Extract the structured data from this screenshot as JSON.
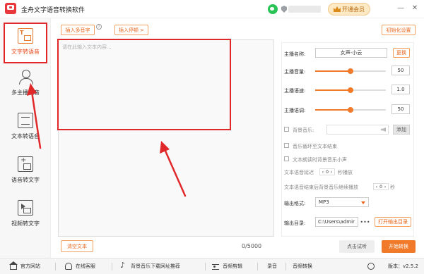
{
  "app": {
    "title": "金舟文字语音转换软件"
  },
  "header": {
    "vip_label": "开通会员",
    "minimize": "—",
    "close": "✕"
  },
  "sidebar": {
    "items": [
      {
        "label": "文字转语音"
      },
      {
        "label": "多主播配音"
      },
      {
        "label": "文本转语音"
      },
      {
        "label": "语音转文字"
      },
      {
        "label": "视频转文字"
      }
    ]
  },
  "toolbar": {
    "insert_polyphone": "插入多音字",
    "help": "?",
    "insert_pause": "插入停顿 >",
    "init_settings": "初始化设置"
  },
  "editor": {
    "placeholder": "请在此输入文本内容...",
    "counter": "0/5000",
    "clear_label": "清空文本"
  },
  "settings": {
    "anchor_name_label": "主播名称:",
    "anchor_name_value": "女声-小云",
    "change_label": "更换",
    "volume_label": "主播音量:",
    "volume_value": "50",
    "speed_label": "主播语速:",
    "speed_value": "1.0",
    "pitch_label": "主播语调:",
    "pitch_value": "50",
    "bgm_label": "背景音乐:",
    "add_label": "添加",
    "loop_label": "音乐循环至文本结束",
    "lower_label": "文本朗读时背景音乐小声",
    "delay_prefix": "文本语音延迟",
    "delay_value": "0",
    "delay_suffix": "秒播放",
    "after_prefix": "文本语音结束后背景音乐继续播放",
    "after_value": "0",
    "after_suffix": "秒",
    "format_label": "输出格式:",
    "format_value": "MP3",
    "dir_label": "输出目录:",
    "dir_value": "C:\\Users\\admir",
    "dir_more": "•••",
    "open_dir_label": "打开输出目录"
  },
  "actions": {
    "preview_label": "点击试听",
    "start_label": "开始转换"
  },
  "footer": {
    "items": [
      {
        "label": "官方网站"
      },
      {
        "label": "在线客服"
      },
      {
        "label": "背景音乐下载网址推荐"
      },
      {
        "label": "音频剪辑"
      },
      {
        "label": "录音"
      },
      {
        "label": "音频转换"
      }
    ],
    "version": "版本：v2.5.2"
  },
  "colors": {
    "accent": "#f07a2a",
    "highlight": "#e0282a",
    "brand": "#e8383d"
  },
  "sliders": {
    "volume": 0.5,
    "speed": 0.5,
    "pitch": 0.5
  }
}
